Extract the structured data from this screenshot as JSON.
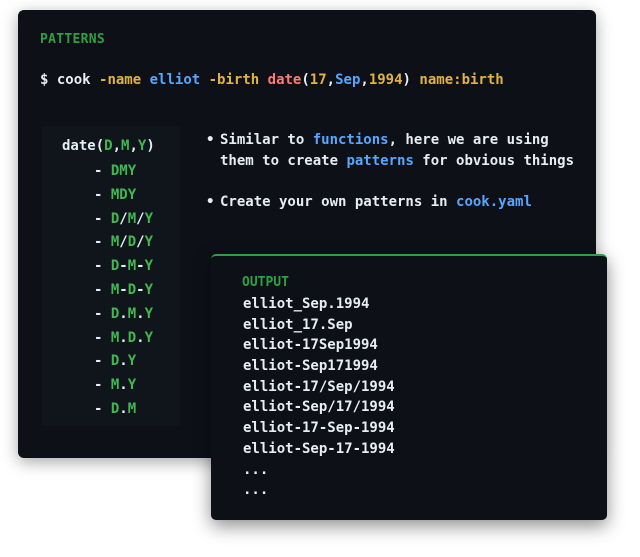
{
  "colors": {
    "panel_bg": "#0d1117",
    "green": "#2ea043",
    "yellow": "#e3b341",
    "blue": "#58a6ff",
    "red": "#ff7b72",
    "text": "#e6edf3"
  },
  "heading": "PATTERNS",
  "command": {
    "prompt": "$ ",
    "bin": "cook",
    "flag_name": "-name",
    "name_value": "elliot",
    "flag_birth": "-birth",
    "func": "date",
    "paren_open": "(",
    "arg_day": "17",
    "comma1": ",",
    "arg_month": "Sep",
    "comma2": ",",
    "arg_year": "1994",
    "paren_close": ")",
    "tail": "name:birth"
  },
  "patterns": {
    "title": {
      "func": "date(",
      "d": "D",
      "c1": ",",
      "m": "M",
      "c2": ",",
      "y": "Y",
      "close": ")"
    },
    "items": [
      "DMY",
      "MDY",
      "D/M/Y",
      "M/D/Y",
      "D-M-Y",
      "M-D-Y",
      "D.M.Y",
      "M.D.Y",
      "D.Y",
      "M.Y",
      "D.M"
    ],
    "dash": "- "
  },
  "bullets": {
    "dot": "•",
    "b1_a": "Similar to ",
    "b1_hl1": "functions",
    "b1_b": ", here we are using",
    "b1_c": "them to create ",
    "b1_hl2": "patterns",
    "b1_d": " for obvious things",
    "b2_a": "Create your own patterns in ",
    "b2_hl": "cook.yaml"
  },
  "output": {
    "title": "OUTPUT",
    "lines": [
      "elliot_Sep.1994",
      "elliot_17.Sep",
      "elliot-17Sep1994",
      "elliot-Sep171994",
      "elliot-17/Sep/1994",
      "elliot-Sep/17/1994",
      "elliot-17-Sep-1994",
      "elliot-Sep-17-1994",
      "...",
      "..."
    ]
  }
}
